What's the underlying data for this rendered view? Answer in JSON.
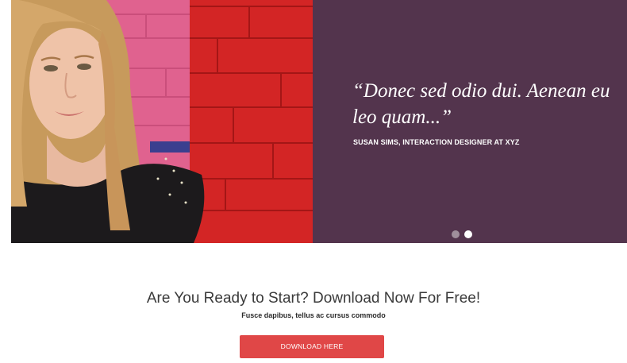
{
  "testimonial": {
    "quote": "“Donec sed odio dui. Aenean eu leo quam...”",
    "author": "SUSAN SIMS, INTERACTION DESIGNER AT XYZ",
    "slides_total": 2,
    "active_slide": 2,
    "background_color": "#53344d"
  },
  "photo": {
    "description_icon": "portrait-photo"
  },
  "cta": {
    "title": "Are You Ready to Start? Download Now For Free!",
    "subtitle": "Fusce dapibus, tellus ac cursus commodo",
    "button_label": "DOWNLOAD HERE",
    "button_color": "#e04747"
  }
}
